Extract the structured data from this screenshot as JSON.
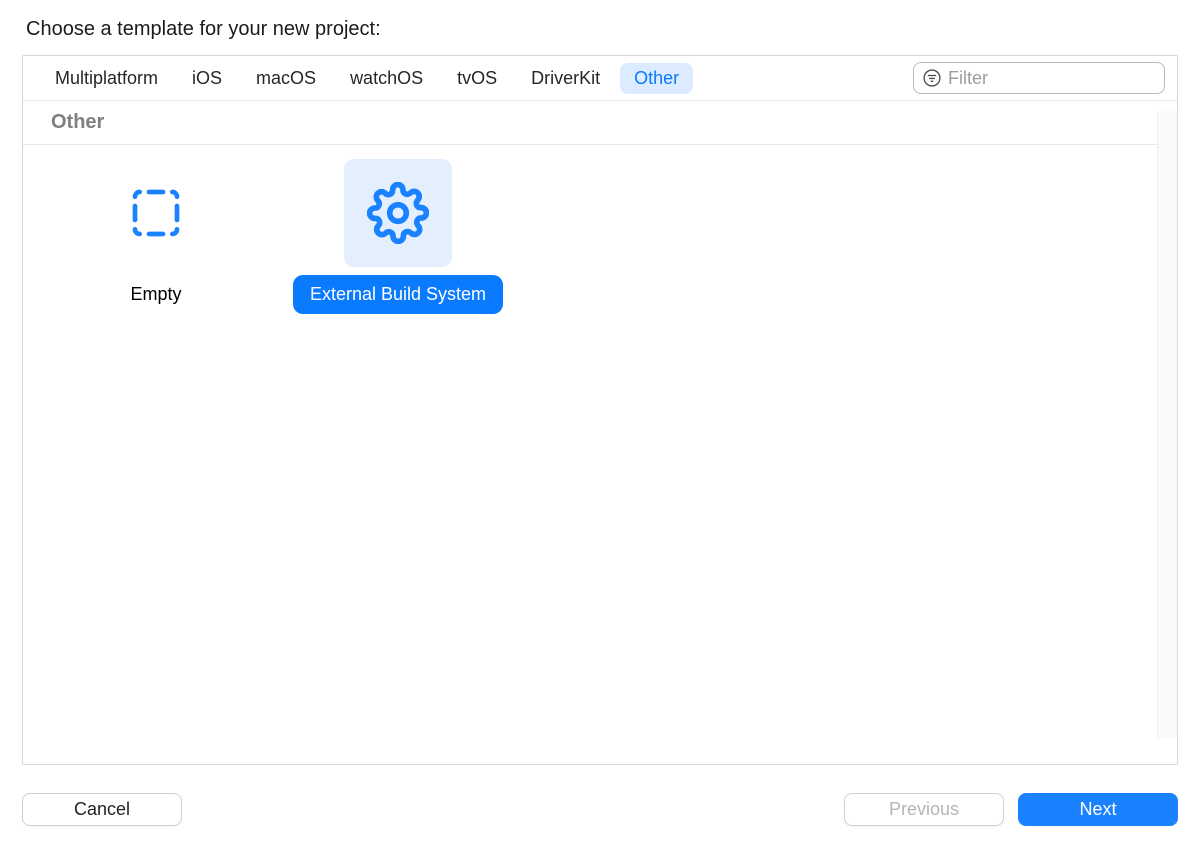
{
  "heading": "Choose a template for your new project:",
  "tabs": [
    {
      "label": "Multiplatform",
      "selected": false
    },
    {
      "label": "iOS",
      "selected": false
    },
    {
      "label": "macOS",
      "selected": false
    },
    {
      "label": "watchOS",
      "selected": false
    },
    {
      "label": "tvOS",
      "selected": false
    },
    {
      "label": "DriverKit",
      "selected": false
    },
    {
      "label": "Other",
      "selected": true
    }
  ],
  "filter": {
    "placeholder": "Filter",
    "value": ""
  },
  "section": {
    "title": "Other"
  },
  "templates": [
    {
      "id": "empty",
      "label": "Empty",
      "icon": "dashed-square-icon",
      "selected": false
    },
    {
      "id": "external-build-system",
      "label": "External Build System",
      "icon": "gear-icon",
      "selected": true
    }
  ],
  "buttons": {
    "cancel": "Cancel",
    "previous": "Previous",
    "next": "Next"
  },
  "colors": {
    "accent": "#0a7aff",
    "tab_selected_bg": "#dcebff",
    "icon_blue": "#1a82ff"
  }
}
